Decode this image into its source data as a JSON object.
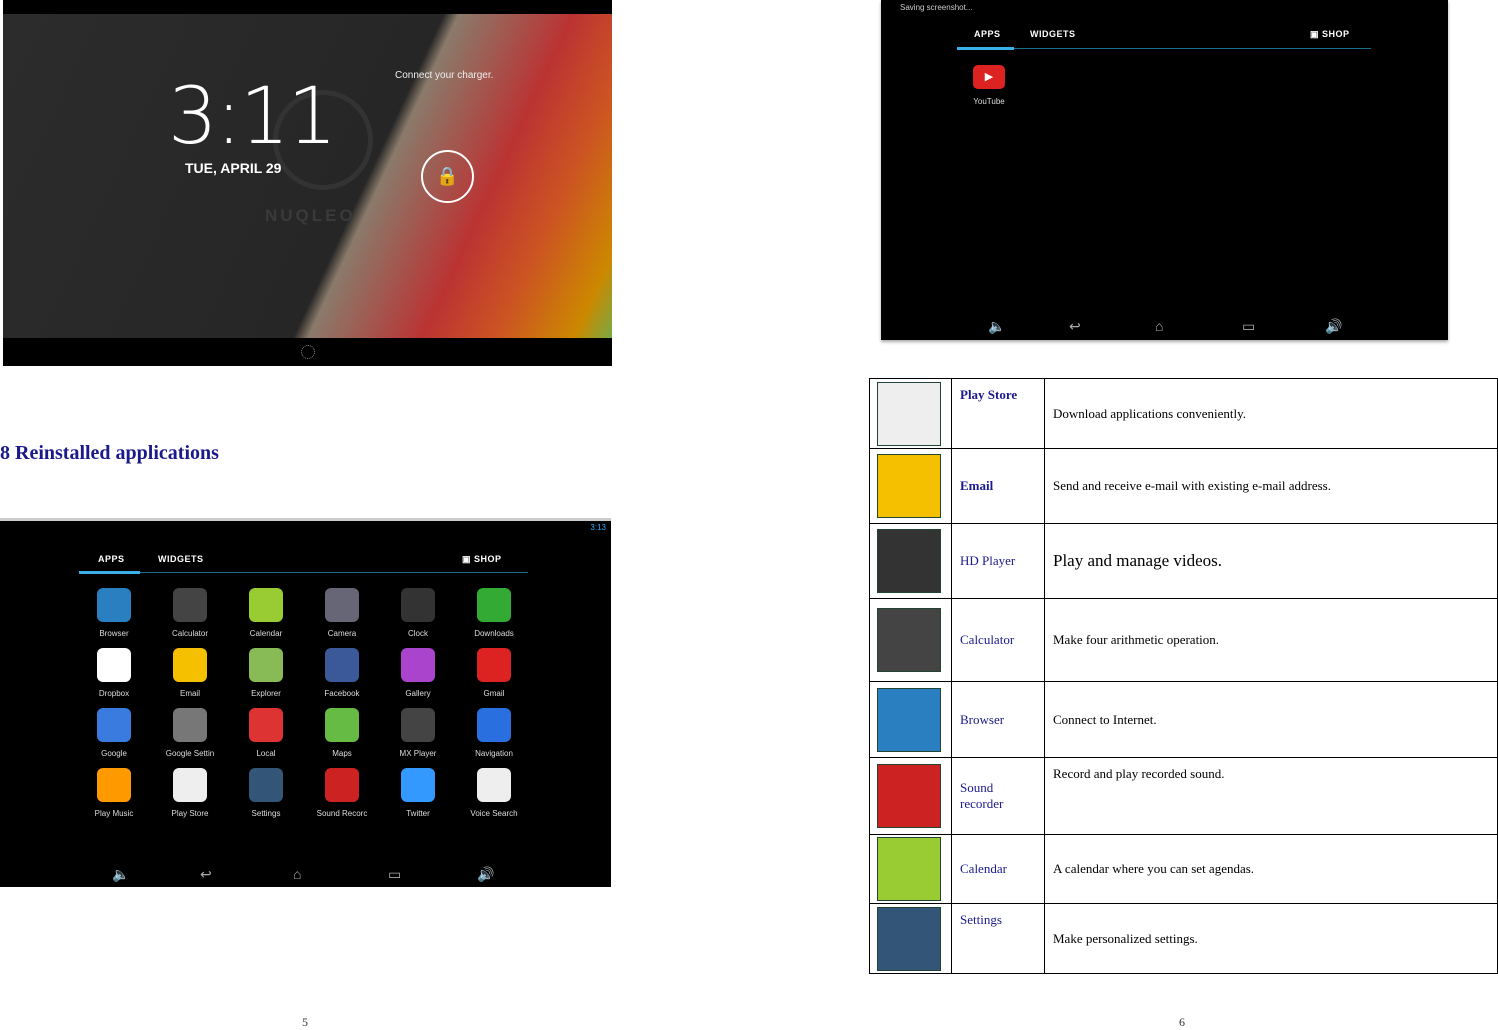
{
  "lockscreen": {
    "time": "3:11",
    "date": "TUE, APRIL 29",
    "charger_msg": "Connect your charger.",
    "brand": "NUQLEO"
  },
  "section_title": "8 Reinstalled applications",
  "drawer": {
    "tabs": [
      "APPS",
      "WIDGETS"
    ],
    "shop": "SHOP",
    "status_time": "3:13",
    "apps": [
      {
        "label": "Browser",
        "color": "#2a7fc0"
      },
      {
        "label": "Calculator",
        "color": "#444"
      },
      {
        "label": "Calendar",
        "color": "#9c3"
      },
      {
        "label": "Camera",
        "color": "#667"
      },
      {
        "label": "Clock",
        "color": "#333"
      },
      {
        "label": "Downloads",
        "color": "#3a3"
      },
      {
        "label": "Dropbox",
        "color": "#fff"
      },
      {
        "label": "Email",
        "color": "#f5c000"
      },
      {
        "label": "Explorer",
        "color": "#8b5"
      },
      {
        "label": "Facebook",
        "color": "#3b5998"
      },
      {
        "label": "Gallery",
        "color": "#a4c"
      },
      {
        "label": "Gmail",
        "color": "#d22"
      },
      {
        "label": "Google",
        "color": "#3a7be0"
      },
      {
        "label": "Google Settin",
        "color": "#777"
      },
      {
        "label": "Local",
        "color": "#d33"
      },
      {
        "label": "Maps",
        "color": "#6b4"
      },
      {
        "label": "MX Player",
        "color": "#444"
      },
      {
        "label": "Navigation",
        "color": "#2a6fe0"
      },
      {
        "label": "Play Music",
        "color": "#f90"
      },
      {
        "label": "Play Store",
        "color": "#eee"
      },
      {
        "label": "Settings",
        "color": "#357"
      },
      {
        "label": "Sound Recorc",
        "color": "#c22"
      },
      {
        "label": "Twitter",
        "color": "#39f"
      },
      {
        "label": "Voice Search",
        "color": "#eee"
      }
    ]
  },
  "shot": {
    "status": "Saving screenshot...",
    "tabs": [
      "APPS",
      "WIDGETS"
    ],
    "shop": "SHOP",
    "app": "YouTube"
  },
  "apps_table": [
    {
      "name": "Play  Store",
      "bold": true,
      "desc": "Download applications conveniently.",
      "color": "#eee"
    },
    {
      "name": "Email",
      "bold": true,
      "desc": "Send and receive e-mail with existing e-mail address.",
      "color": "#f5c000"
    },
    {
      "name": "HD Player",
      "desc": "Play and manage videos.",
      "color": "#333",
      "big": true
    },
    {
      "name": "Calculator",
      "desc": "Make four arithmetic operation.",
      "color": "#444"
    },
    {
      "name": "Browser",
      "desc": "Connect to Internet.",
      "color": "#2a7fc0"
    },
    {
      "name": "Sound recorder",
      "desc": "Record and play recorded sound.",
      "color": "#c22"
    },
    {
      "name": "Calendar",
      "desc": "A calendar where you can set agendas.",
      "color": "#9c3"
    },
    {
      "name": "Settings",
      "desc": "Make personalized settings.",
      "color": "#357"
    }
  ],
  "page_numbers": [
    "5",
    "6"
  ]
}
